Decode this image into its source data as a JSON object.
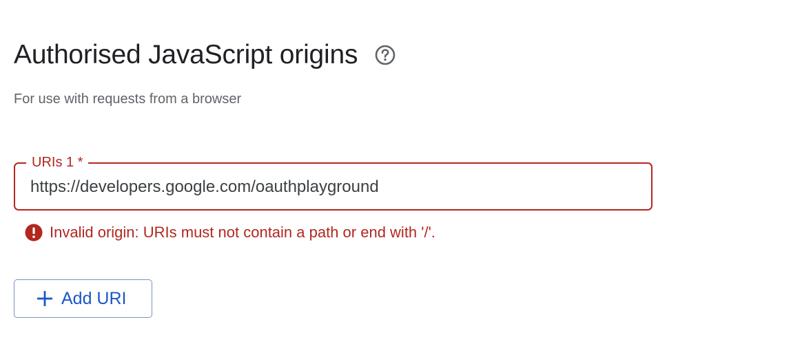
{
  "section": {
    "title": "Authorised JavaScript origins",
    "help_icon": "help-circle-icon",
    "subtitle": "For use with requests from a browser"
  },
  "uri_field": {
    "label": "URIs 1 *",
    "value": "https://developers.google.com/oauthplayground",
    "state": "error"
  },
  "error": {
    "icon": "error-circle-icon",
    "message": "Invalid origin: URIs must not contain a path or end with '/'."
  },
  "add_button": {
    "icon": "plus-icon",
    "label": "Add URI"
  },
  "colors": {
    "title_text": "#202124",
    "subtitle_text": "#5f6368",
    "error": "#b3261e",
    "primary": "#1a56c8",
    "button_border": "#7c8fbf"
  }
}
